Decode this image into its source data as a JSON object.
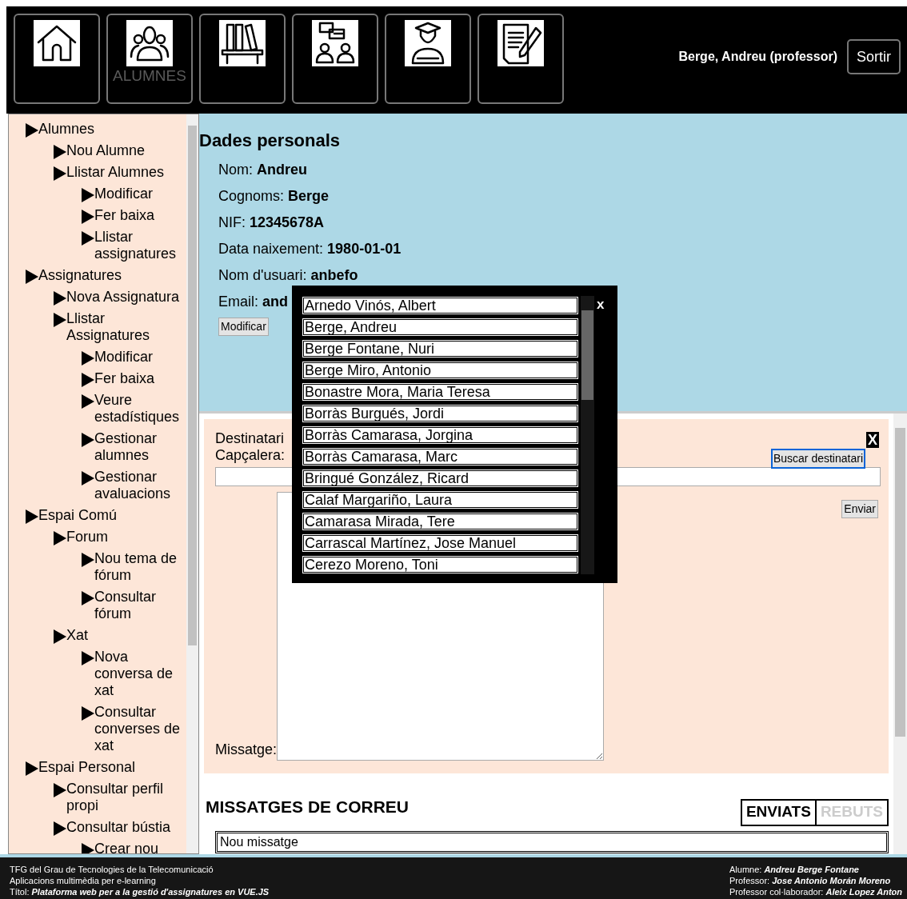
{
  "nav": {
    "buttons": [
      {
        "kind": "home"
      },
      {
        "kind": "students",
        "label": "ALUMNES"
      },
      {
        "kind": "books"
      },
      {
        "kind": "chat"
      },
      {
        "kind": "graduate"
      },
      {
        "kind": "notes"
      }
    ],
    "user": "Berge, Andreu (professor)",
    "logout": "Sortir"
  },
  "sidebar": {
    "items": [
      {
        "label": "Alumnes",
        "children": [
          {
            "label": "Nou Alumne"
          },
          {
            "label": "Llistar Alumnes",
            "children": [
              {
                "label": "Modificar"
              },
              {
                "label": "Fer baixa"
              },
              {
                "label": "Llistar assignatures"
              }
            ]
          }
        ]
      },
      {
        "label": "Assignatures",
        "children": [
          {
            "label": "Nova Assignatura"
          },
          {
            "label": "Llistar Assignatures",
            "children": [
              {
                "label": "Modificar"
              },
              {
                "label": "Fer baixa"
              },
              {
                "label": "Veure estadístiques"
              },
              {
                "label": "Gestionar alumnes"
              },
              {
                "label": "Gestionar avaluacions"
              }
            ]
          }
        ]
      },
      {
        "label": "Espai Comú",
        "children": [
          {
            "label": "Forum",
            "children": [
              {
                "label": "Nou tema de fórum"
              },
              {
                "label": "Consultar fórum"
              }
            ]
          },
          {
            "label": "Xat",
            "children": [
              {
                "label": "Nova conversa de xat"
              },
              {
                "label": "Consultar converses de xat"
              }
            ]
          }
        ]
      },
      {
        "label": "Espai Personal",
        "children": [
          {
            "label": "Consultar perfil propi"
          },
          {
            "label": "Consultar bústia",
            "children": [
              {
                "label": "Crear nou"
              }
            ]
          }
        ]
      }
    ]
  },
  "profile": {
    "title": "Dades personals",
    "fields": [
      {
        "label": "Nom:",
        "value": "Andreu"
      },
      {
        "label": "Cognoms:",
        "value": "Berge"
      },
      {
        "label": "NIF:",
        "value": "12345678A"
      },
      {
        "label": "Data naixement:",
        "value": "1980-01-01"
      },
      {
        "label": "Nom d'usuari:",
        "value": "anbefo"
      },
      {
        "label": "Email:",
        "value": "and"
      }
    ],
    "button": "Modificar"
  },
  "compose": {
    "recipient_label": "Destinatari",
    "subject_label": "Capçalera:",
    "close": "X",
    "search_button": "Buscar destinatari",
    "send_button": "Enviar",
    "message_label": "Missatge:"
  },
  "recipient_popup": {
    "close": "x",
    "names": [
      "Arnedo Vinós, Albert",
      "Berge, Andreu",
      "Berge Fontane, Nuri",
      "Berge Miro, Antonio",
      "Bonastre Mora, Maria Teresa",
      "Borràs Burgués, Jordi",
      "Borràs Camarasa, Jorgina",
      "Borràs Camarasa, Marc",
      "Bringué González, Ricard",
      "Calaf Margariño, Laura",
      "Camarasa Mirada, Tere",
      "Carrascal Martínez, Jose Manuel",
      "Cerezo Moreno, Toni"
    ]
  },
  "mail": {
    "title": "MISSATGES DE CORREU",
    "tabs": [
      {
        "label": "ENVIATS",
        "selected": true
      },
      {
        "label": "REBUTS",
        "selected": false
      }
    ],
    "new_message": "Nou missatge"
  },
  "footer": {
    "left": [
      "TFG del Grau de Tecnologies de la Telecomunicació",
      "Aplicacions multimèdia per e-learning",
      "Títol: **Plataforma web per a la gestió d'assignatures en VUE.JS**"
    ],
    "right": [
      "Alumne: **Andreu Berge Fontane**",
      "Professor: **Jose Antonio Morán Moreno**",
      "Professor col·laborador: **Aleix Lopez Anton**"
    ]
  }
}
